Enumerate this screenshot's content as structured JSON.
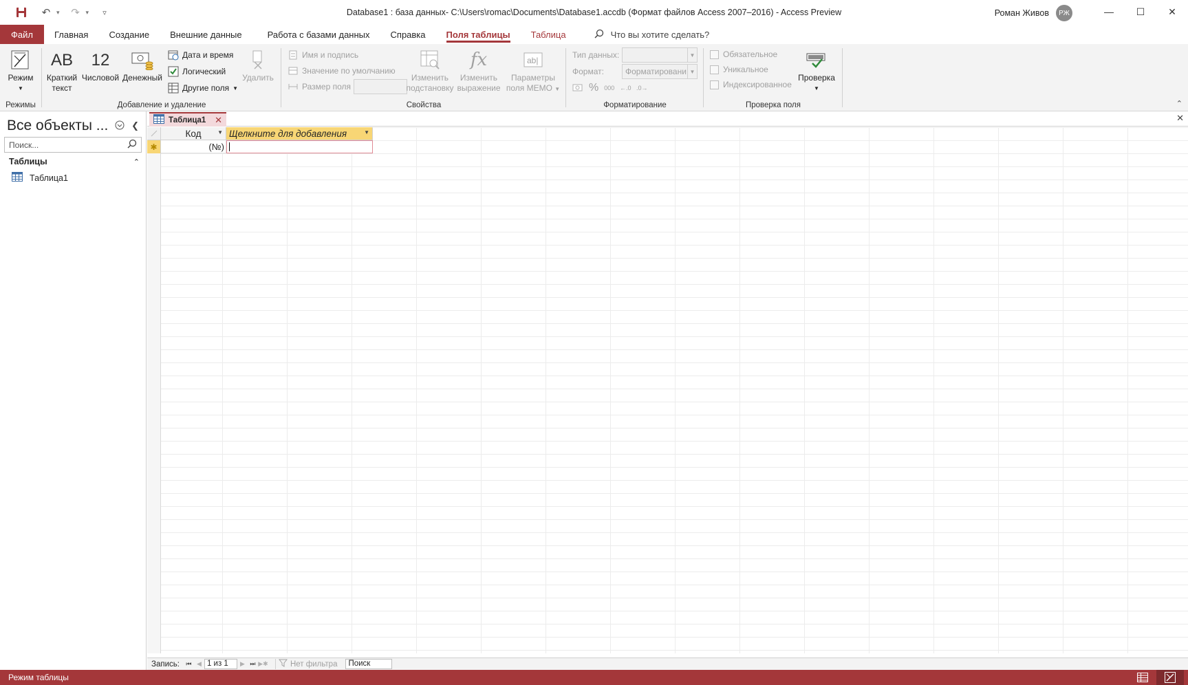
{
  "window": {
    "title": "Database1 : база данных- C:\\Users\\romac\\Documents\\Database1.accdb (Формат файлов Access 2007–2016)  -  Access Preview",
    "user_name": "Роман Живов",
    "user_initials": "РЖ"
  },
  "tabs": [
    {
      "label": "Файл"
    },
    {
      "label": "Главная"
    },
    {
      "label": "Создание"
    },
    {
      "label": "Внешние данные"
    },
    {
      "label": "Работа с базами данных"
    },
    {
      "label": "Справка"
    },
    {
      "label": "Поля таблицы"
    },
    {
      "label": "Таблица"
    }
  ],
  "tellme_placeholder": "Что вы хотите сделать?",
  "ribbon": {
    "modes": {
      "view_label": "Режим",
      "group_label": "Режимы"
    },
    "add_delete": {
      "short_text_icon": "AB",
      "short_text_label_1": "Краткий",
      "short_text_label_2": "текст",
      "number_icon": "12",
      "number_label": "Числовой",
      "currency_label": "Денежный",
      "datetime_label": "Дата и время",
      "yesno_label": "Логический",
      "more_fields_label": "Другие поля",
      "delete_label": "Удалить",
      "group_label": "Добавление и удаление"
    },
    "properties": {
      "name_caption_label": "Имя и подпись",
      "default_value_label": "Значение по умолчанию",
      "field_size_label": "Размер поля",
      "modify_lookups_label_1": "Изменить",
      "modify_lookups_label_2": "подстановку",
      "modify_expression_label_1": "Изменить",
      "modify_expression_label_2": "выражение",
      "memo_settings_label_1": "Параметры",
      "memo_settings_label_2": "поля MEMO",
      "group_label": "Свойства"
    },
    "formatting": {
      "data_type_label": "Тип данных:",
      "data_type_value": "",
      "format_label": "Формат:",
      "format_value": "Форматировани",
      "percent_symbol": "%",
      "thousands_symbol": "000",
      "group_label": "Форматирование"
    },
    "validation": {
      "required_label": "Обязательное",
      "unique_label": "Уникальное",
      "indexed_label": "Индексированное",
      "validation_label": "Проверка",
      "group_label": "Проверка поля"
    }
  },
  "nav_pane": {
    "title": "Все объекты ...",
    "search_placeholder": "Поиск...",
    "group_label": "Таблицы",
    "items": [
      {
        "label": "Таблица1"
      }
    ]
  },
  "document": {
    "tab_label": "Таблица1",
    "columns": [
      {
        "label": "Код"
      },
      {
        "label": "Щелкните для добавления"
      }
    ],
    "new_row_id_placeholder": "(№)"
  },
  "record_nav": {
    "record_label": "Запись:",
    "position": "1 из 1",
    "filter_label": "Нет фильтра",
    "search_label": "Поиск"
  },
  "status_bar": {
    "text": "Режим таблицы"
  },
  "colors": {
    "accent": "#a4373a",
    "add_column_bg": "#f8d675"
  }
}
